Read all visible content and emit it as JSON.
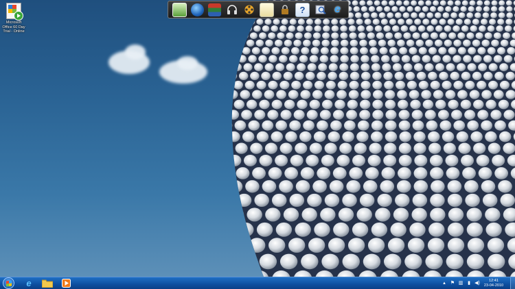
{
  "desktop": {
    "shortcuts": [
      {
        "label": "Microsoft Office 60 Day Trial - Online",
        "icon": "office-trial-icon"
      }
    ]
  },
  "toolbar": {
    "icons": [
      {
        "name": "photo-viewer-icon"
      },
      {
        "name": "globe-icon"
      },
      {
        "name": "books-icon"
      },
      {
        "name": "headphones-icon"
      },
      {
        "name": "film-reel-icon"
      },
      {
        "name": "notepad-icon"
      },
      {
        "name": "lock-icon"
      },
      {
        "name": "help-icon",
        "glyph": "?"
      },
      {
        "name": "magnifier-icon"
      },
      {
        "name": "internet-explorer-icon",
        "glyph": "e"
      }
    ]
  },
  "taskbar": {
    "pinned": [
      {
        "name": "internet-explorer-icon",
        "glyph": "e"
      },
      {
        "name": "windows-explorer-icon"
      },
      {
        "name": "media-player-icon"
      }
    ],
    "tray": {
      "icons": [
        "show-hidden-icons-icon",
        "action-center-flag-icon",
        "network-icon",
        "power-icon",
        "volume-icon"
      ],
      "time": "12:41",
      "date": "23-04-2010"
    }
  },
  "colors": {
    "sky_top": "#1f4f7e",
    "taskbar": "#0d4fa0"
  }
}
